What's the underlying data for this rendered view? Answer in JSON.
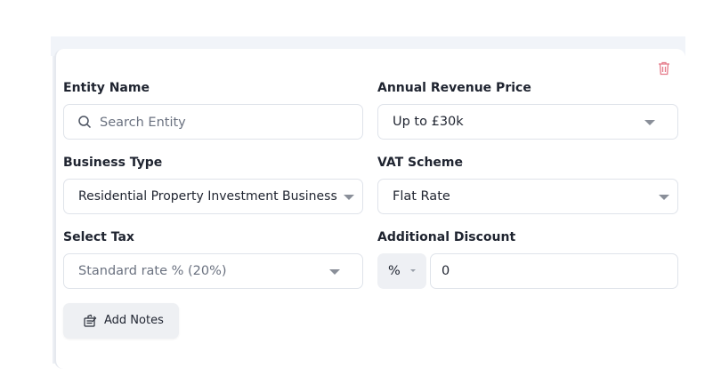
{
  "form": {
    "entity_name": {
      "label": "Entity Name",
      "placeholder": "Search Entity"
    },
    "annual_revenue": {
      "label": "Annual Revenue Price",
      "value": "Up to £30k"
    },
    "business_type": {
      "label": "Business Type",
      "value": "Residential Property Investment Business"
    },
    "vat_scheme": {
      "label": "VAT Scheme",
      "value": "Flat Rate"
    },
    "select_tax": {
      "label": "Select Tax",
      "value": "Standard rate % (20%)"
    },
    "additional_discount": {
      "label": "Additional Discount",
      "unit": "%",
      "value": "0"
    },
    "add_notes_label": "Add Notes"
  },
  "icons": {
    "delete": "trash-icon",
    "search": "search-icon",
    "notes": "notes-icon"
  },
  "colors": {
    "delete_icon": "#e57b8a",
    "border": "#dfe3ea",
    "button_bg": "#eef0f3"
  }
}
